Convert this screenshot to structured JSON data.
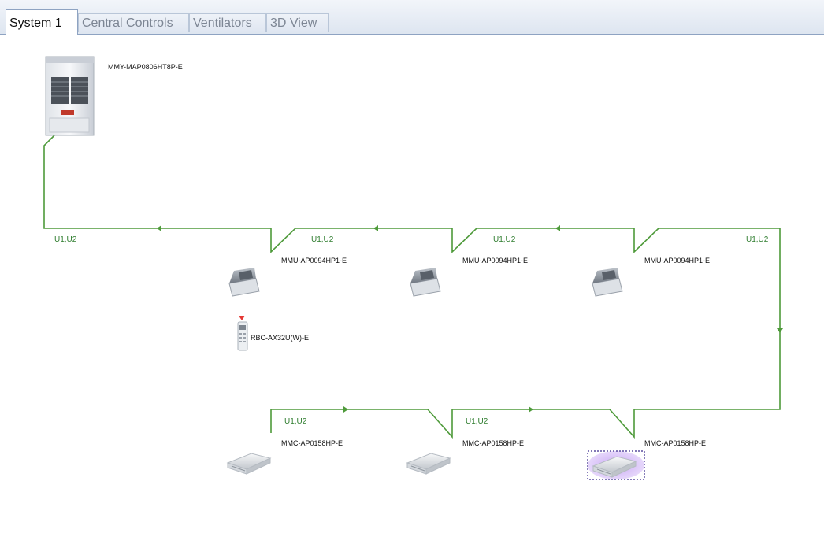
{
  "tabs": [
    {
      "label": "System 1",
      "active": true
    },
    {
      "label": "Central Controls",
      "active": false
    },
    {
      "label": "Ventilators",
      "active": false
    },
    {
      "label": "3D View",
      "active": false
    }
  ],
  "diagram": {
    "wire_color": "#4e9a3a",
    "outdoor_unit": {
      "model": "MMY-MAP0806HT8P-E"
    },
    "wire_labels": [
      "U1,U2",
      "U1,U2",
      "U1,U2",
      "U1,U2",
      "U1,U2",
      "U1,U2"
    ],
    "cassette_units": [
      {
        "model": "MMU-AP0094HP1-E"
      },
      {
        "model": "MMU-AP0094HP1-E"
      },
      {
        "model": "MMU-AP0094HP1-E"
      }
    ],
    "remote_controller": {
      "model": "RBC-AX32U(W)-E"
    },
    "ceiling_units": [
      {
        "model": "MMC-AP0158HP-E",
        "selected": false
      },
      {
        "model": "MMC-AP0158HP-E",
        "selected": false
      },
      {
        "model": "MMC-AP0158HP-E",
        "selected": true
      }
    ],
    "selection_color": "#8a4fd6"
  }
}
